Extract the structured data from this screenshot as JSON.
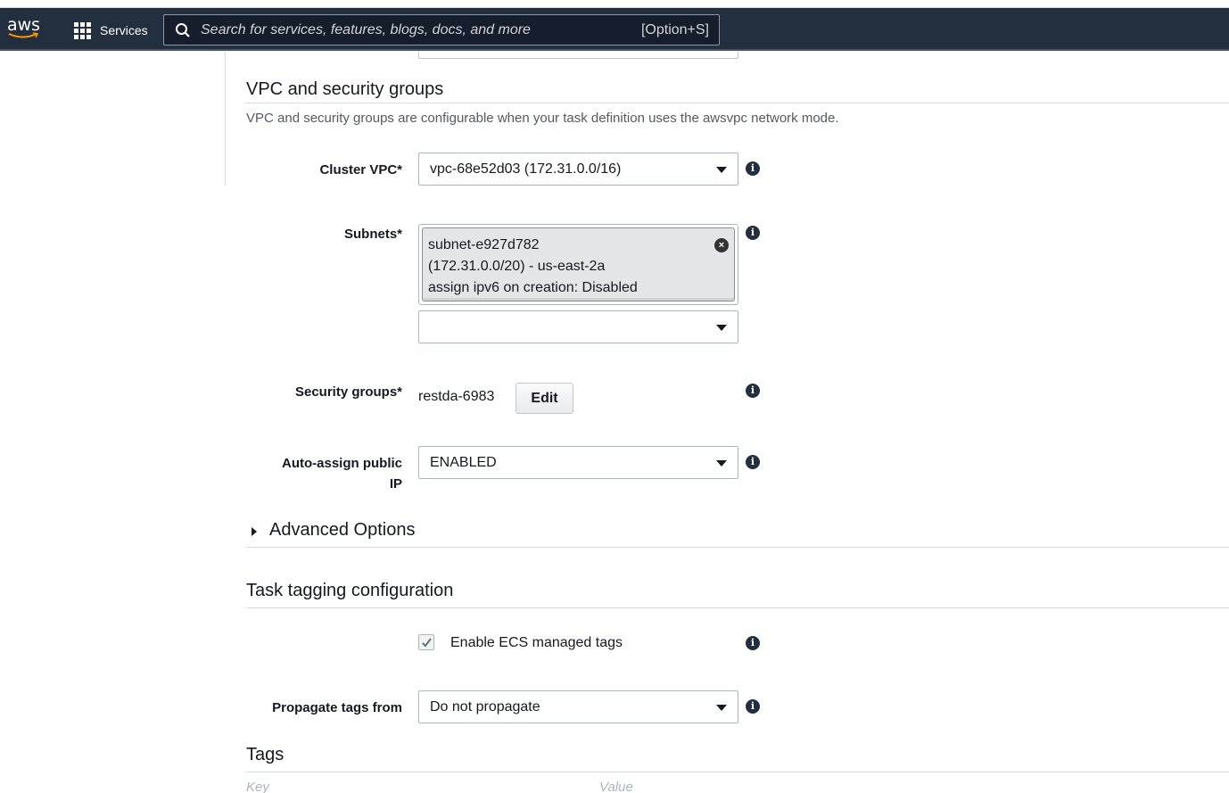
{
  "topbar": {
    "logo_text": "aws",
    "services_label": "Services",
    "search_placeholder": "Search for services, features, blogs, docs, and more",
    "search_shortcut": "[Option+S]",
    "icons": [
      "apps-grid-icon",
      "search-icon"
    ]
  },
  "vpc_section": {
    "title": "VPC and security groups",
    "description": "VPC and security groups are configurable when your task definition uses the awsvpc network mode.",
    "cluster_vpc": {
      "label": "Cluster VPC*",
      "value": "vpc-68e52d03 (172.31.0.0/16)"
    },
    "subnets": {
      "label": "Subnets*",
      "selected": {
        "line1": "subnet-e927d782",
        "line2": "(172.31.0.0/20) - us-east-2a",
        "line3": "assign ipv6 on creation: Disabled"
      },
      "add_value": ""
    },
    "security_groups": {
      "label": "Security groups*",
      "value": "restda-6983",
      "edit_label": "Edit"
    },
    "auto_assign": {
      "label_line1": "Auto-assign public",
      "label_line2": "IP",
      "value": "ENABLED"
    }
  },
  "advanced": {
    "label": "Advanced Options",
    "expanded": false
  },
  "tagging_section": {
    "title": "Task tagging configuration",
    "enable_managed_tags": {
      "label": "Enable ECS managed tags",
      "checked": true
    },
    "propagate": {
      "label": "Propagate tags from",
      "value": "Do not propagate"
    }
  },
  "tags_section": {
    "title": "Tags",
    "columns": [
      "Key",
      "Value"
    ]
  },
  "colors": {
    "topbar": "#232f3e",
    "text": "#16191f",
    "muted": "#545b64",
    "border": "#aab7b8"
  }
}
